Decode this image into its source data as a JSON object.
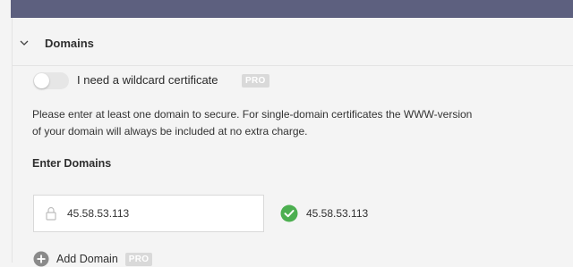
{
  "domains_section": {
    "title": "Domains",
    "wildcard": {
      "label": "I need a wildcard certificate",
      "badge": "PRO",
      "enabled": false
    },
    "description": "Please enter at least one domain to secure. For single-domain certificates the WWW-version of your domain will always be included at no extra charge.",
    "enter_label": "Enter Domains",
    "domain_input": {
      "value": "45.58.53.113"
    },
    "validated": {
      "text": "45.58.53.113",
      "status_color": "#4caf50"
    },
    "add_domain": {
      "label": "Add Domain",
      "badge": "PRO"
    }
  },
  "colors": {
    "header_bar": "#5d607f",
    "badge_bg": "#d9d9d9"
  },
  "icons": {
    "collapse": "chevron-down-icon",
    "lock": "lock-icon",
    "check": "check-circle-icon",
    "add": "plus-circle-icon"
  }
}
